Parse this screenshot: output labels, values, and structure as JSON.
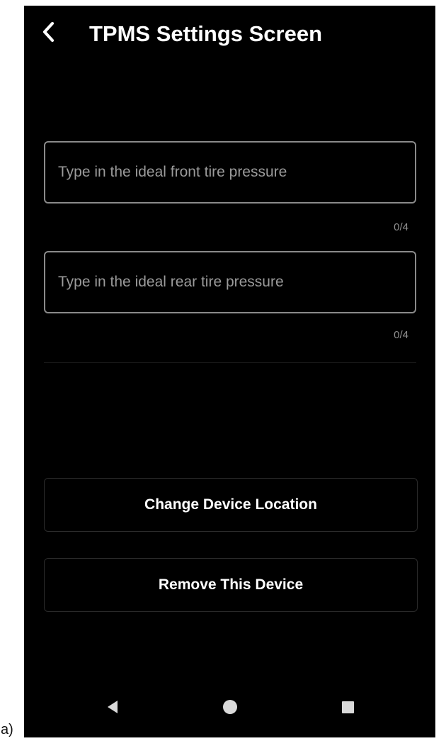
{
  "figure_label": "a)",
  "header": {
    "title": "TPMS Settings Screen",
    "back_icon": "chevron-left-icon"
  },
  "fields": {
    "front": {
      "placeholder": "Type in the ideal front tire pressure",
      "value": "",
      "counter": "0/4"
    },
    "rear": {
      "placeholder": "Type in the ideal rear tire pressure",
      "value": "",
      "counter": "0/4"
    }
  },
  "actions": {
    "change_location": "Change Device Location",
    "remove_device": "Remove This Device"
  },
  "navbar": {
    "back_icon": "back-triangle-icon",
    "home_icon": "home-circle-icon",
    "recents_icon": "recents-square-icon"
  },
  "colors": {
    "background": "#000000",
    "text": "#ffffff",
    "placeholder": "#9a9a9a",
    "field_border": "#8a8a8a",
    "button_border": "#2b2b2b",
    "nav_icons": "#d9d9d9"
  }
}
